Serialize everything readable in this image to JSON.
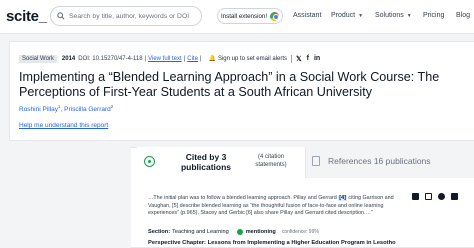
{
  "nav": {
    "logo": "scite_",
    "search_placeholder": "Search by title, author, keywords or DOI",
    "install_label": "Install extension!",
    "links": [
      {
        "label": "Assistant",
        "has_menu": false
      },
      {
        "label": "Product",
        "has_menu": true
      },
      {
        "label": "Solutions",
        "has_menu": true
      },
      {
        "label": "Pricing",
        "has_menu": false
      },
      {
        "label": "Blog",
        "has_menu": false
      }
    ]
  },
  "paper": {
    "category": "Social Work",
    "year": "2014",
    "doi": "DOI: 10.15270/47-4-118",
    "full_text": "View full text",
    "cite": "Cite",
    "alert": "Sign up to set email alerts",
    "title": "Implementing a “Blended Learning Approach” in a Social Work Course: The Perceptions of First-Year Students at a South African University",
    "authors": [
      {
        "name": "Roshini Pillay",
        "sup": "1"
      },
      {
        "name": "Priscilla Gerrard",
        "sup": "2"
      }
    ],
    "help_link": "Help me understand this report"
  },
  "citations": {
    "cited_by_label": "Cited by 3 publications",
    "citation_statements": "(4 citation statements)",
    "references_label": "References 16 publications",
    "snippet_before": "…The initial plan was to follow a blended learning approach. Pillay and Gerrard",
    "snippet_ref": "[4]",
    "snippet_after": "citing Garrison and Vaughan, [5] describe blended learning as “the thoughtful fusion of face-to-face and online learning experiences” (p.965). Stacey and Gerbic [6] also share Pillay and Gerrard cited description.…”",
    "section_label": "Section:",
    "section_value": "Teaching and Learning",
    "mentioning_label": "mentioning",
    "confidence": "confidence: 99%",
    "perspective_title": "Perspective Chapter: Lessons from Implementing a Higher Education Program in Lesotho"
  }
}
